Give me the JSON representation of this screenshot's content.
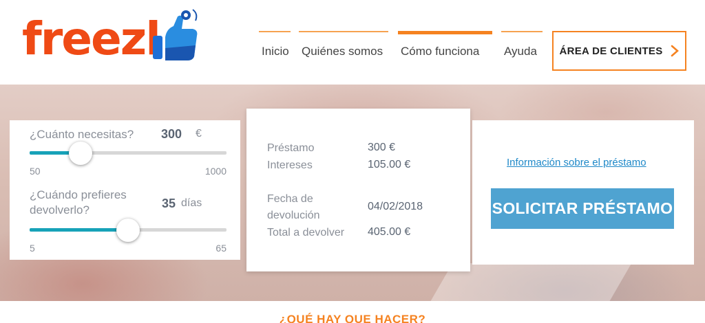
{
  "logo": {
    "text": "freezl"
  },
  "nav": {
    "items": [
      {
        "label": "Inicio"
      },
      {
        "label": "Quiénes somos"
      },
      {
        "label": "Cómo funciona"
      },
      {
        "label": "Ayuda"
      }
    ],
    "active": "Cómo funciona"
  },
  "client_button": {
    "label": "ÁREA DE CLIENTES"
  },
  "calculator": {
    "amount": {
      "question": "¿Cuánto necesitas?",
      "value": "300",
      "unit": "€",
      "min": "50",
      "max": "1000",
      "slider_fraction": 0.26
    },
    "days": {
      "question_line1": "¿Cuándo prefieres",
      "question_line2": "devolverlo?",
      "value": "35",
      "unit": "días",
      "min": "5",
      "max": "65",
      "slider_fraction": 0.5
    }
  },
  "summary": {
    "loan_label": "Préstamo",
    "loan_value": "300 €",
    "interest_label": "Intereses",
    "interest_value": "105.00 €",
    "date_label_line1": "Fecha de",
    "date_label_line2": "devolución",
    "date_value": "04/02/2018",
    "total_label": "Total a devolver",
    "total_value": "405.00 €"
  },
  "actions": {
    "info_link": "Información sobre el préstamo",
    "apply_button": "SOLICITAR PRÉSTAMO"
  },
  "section": {
    "title": "¿QUÉ HAY QUE HACER?"
  },
  "colors": {
    "orange": "#f58220",
    "blue": "#4fa3d1",
    "teal": "#17a2b8"
  }
}
